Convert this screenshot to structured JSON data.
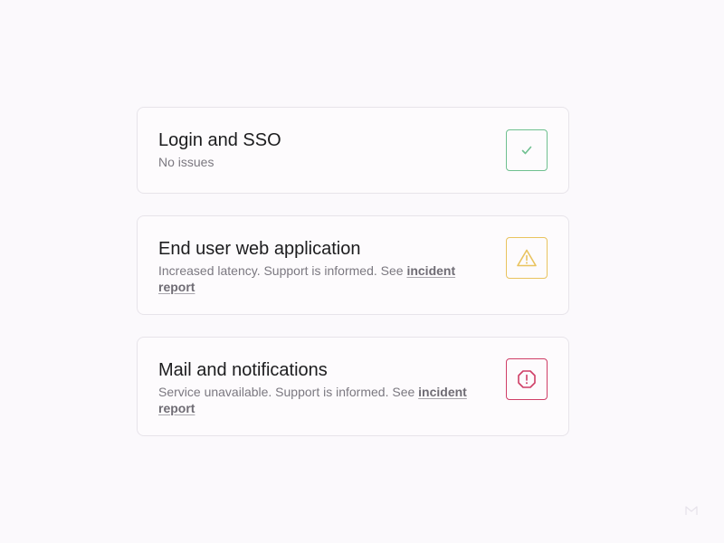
{
  "services": [
    {
      "title": "Login and SSO",
      "description": "No issues",
      "link_text": "",
      "status": "ok",
      "status_icon": "check-icon",
      "status_color": "#6fc090"
    },
    {
      "title": "End user web application",
      "description": "Increased latency. Support is informed. See ",
      "link_text": "incident report",
      "status": "warning",
      "status_icon": "warning-triangle-icon",
      "status_color": "#e9c35e"
    },
    {
      "title": "Mail and notifications",
      "description": "Service unavailable. Support is informed. See ",
      "link_text": "incident report",
      "status": "error",
      "status_icon": "error-octagon-icon",
      "status_color": "#cf3e67"
    }
  ],
  "watermark": "M"
}
